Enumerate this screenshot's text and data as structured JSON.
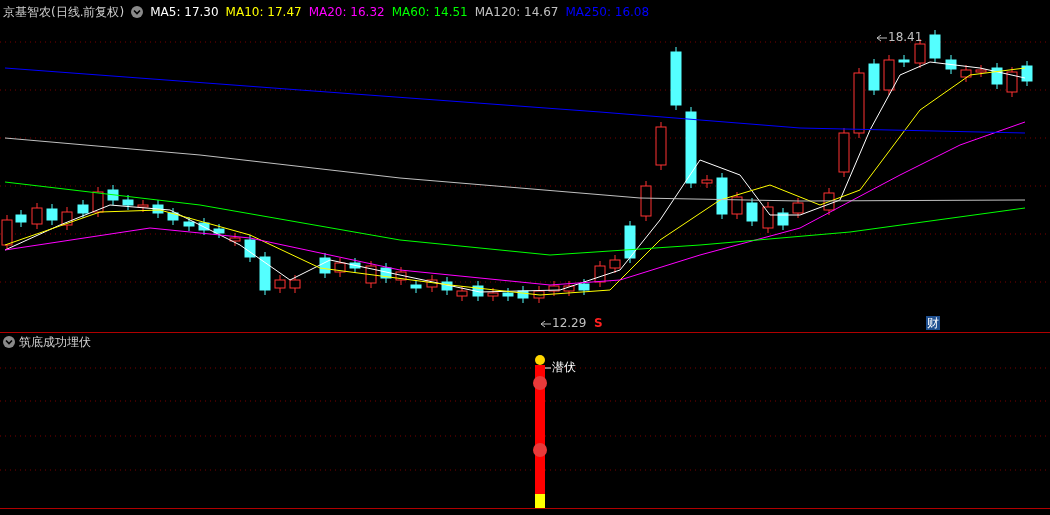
{
  "header": {
    "title": "京基智农(日线.前复权)"
  },
  "moving_averages": [
    {
      "label": "MA5: 17.30",
      "color": "#ffffff"
    },
    {
      "label": "MA10: 17.47",
      "color": "#ffff00"
    },
    {
      "label": "MA20: 16.32",
      "color": "#ff00ff"
    },
    {
      "label": "MA60: 14.51",
      "color": "#00ff00"
    },
    {
      "label": "MA120: 14.67",
      "color": "#c0c0c0"
    },
    {
      "label": "MA250: 16.08",
      "color": "#0000ff"
    }
  ],
  "price_marks": [
    {
      "kind": "high",
      "label": "18.41"
    },
    {
      "kind": "low",
      "label": "12.29"
    }
  ],
  "signals": [
    {
      "kind": "sell",
      "label": "S"
    },
    {
      "kind": "finance",
      "label": "财"
    }
  ],
  "indicator": {
    "title": "筑底成功埋伏",
    "signal_label": "潜伏"
  }
}
